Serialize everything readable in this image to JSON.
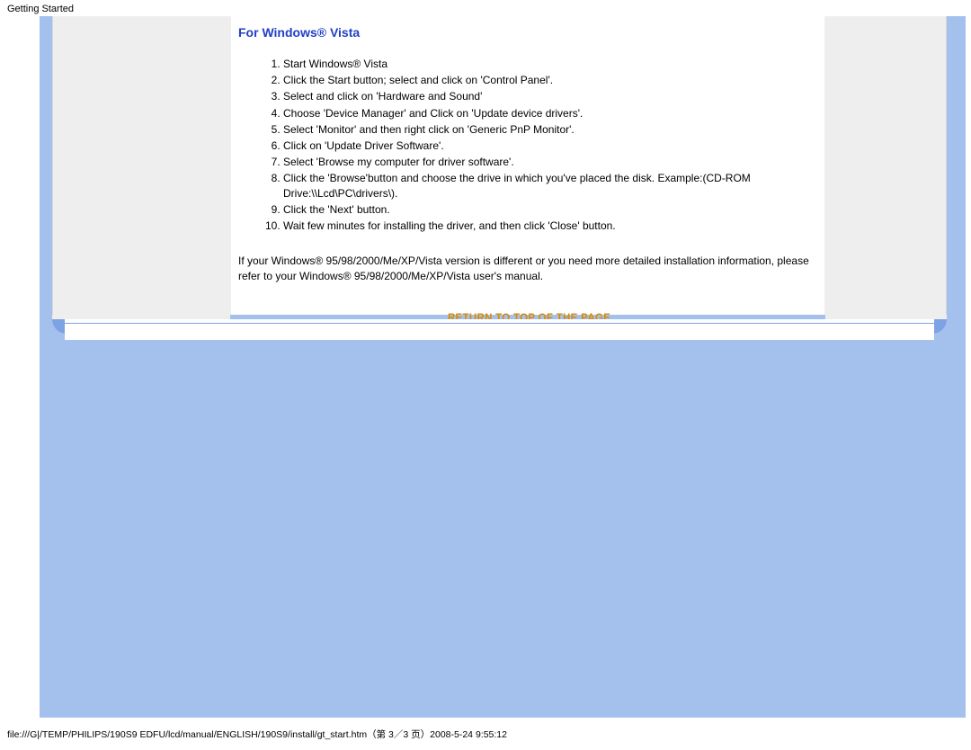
{
  "header": {
    "title": "Getting Started"
  },
  "section": {
    "heading": "For Windows® Vista"
  },
  "steps": [
    "Start Windows® Vista",
    "Click the Start button; select and click on 'Control Panel'.",
    "Select and click on 'Hardware and Sound'",
    "Choose 'Device Manager' and Click on 'Update device drivers'.",
    "Select 'Monitor' and then right click on 'Generic PnP Monitor'.",
    "Click on 'Update Driver Software'.",
    "Select 'Browse my computer for driver software'.",
    "Click the 'Browse'button and choose the drive in which you've placed the disk. Example:(CD-ROM Drive:\\\\Lcd\\PC\\drivers\\).",
    "Click the 'Next' button.",
    "Wait few minutes for installing the driver, and then click 'Close' button."
  ],
  "note": "If your Windows® 95/98/2000/Me/XP/Vista version is different or you need more detailed installation information, please refer to your Windows® 95/98/2000/Me/XP/Vista user's manual.",
  "return_link": "RETURN TO TOP OF THE PAGE",
  "footer": "file:///G|/TEMP/PHILIPS/190S9 EDFU/lcd/manual/ENGLISH/190S9/install/gt_start.htm（第 3／3 页）2008-5-24 9:55:12"
}
